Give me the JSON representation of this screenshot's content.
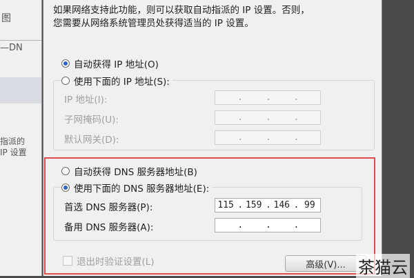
{
  "background": {
    "text_1": "图",
    "text_2": "—DN",
    "text_3": "指派的",
    "text_4": "IP 设置"
  },
  "dialog": {
    "description_line1": "如果网络支持此功能，则可以获取自动指派的 IP 设置。否则，",
    "description_line2": "您需要从网络系统管理员处获得适当的 IP 设置。",
    "ip": {
      "auto_label": "自动获得 IP 地址(O)",
      "auto_selected": true,
      "manual_label": "使用下面的 IP 地址(S):",
      "manual_selected": false,
      "fields": [
        {
          "label": "IP 地址(I):",
          "value": [
            "",
            "",
            "",
            ""
          ]
        },
        {
          "label": "子网掩码(U):",
          "value": [
            "",
            "",
            "",
            ""
          ]
        },
        {
          "label": "默认网关(D):",
          "value": [
            "",
            "",
            "",
            ""
          ]
        }
      ]
    },
    "dns": {
      "auto_label": "自动获得 DNS 服务器地址(B)",
      "auto_selected": false,
      "manual_label": "使用下面的 DNS 服务器地址(E):",
      "manual_selected": true,
      "preferred_label": "首选 DNS 服务器(P):",
      "preferred_value": [
        "115",
        "159",
        "146",
        "99"
      ],
      "alternate_label": "备用 DNS 服务器(A):",
      "alternate_value": [
        "",
        "",
        "",
        ""
      ]
    },
    "validate_label": "退出时验证设置(L)",
    "advanced_label": "高级(V)...",
    "highlight_color": "#e04a4a"
  },
  "watermark": "茶猫云"
}
